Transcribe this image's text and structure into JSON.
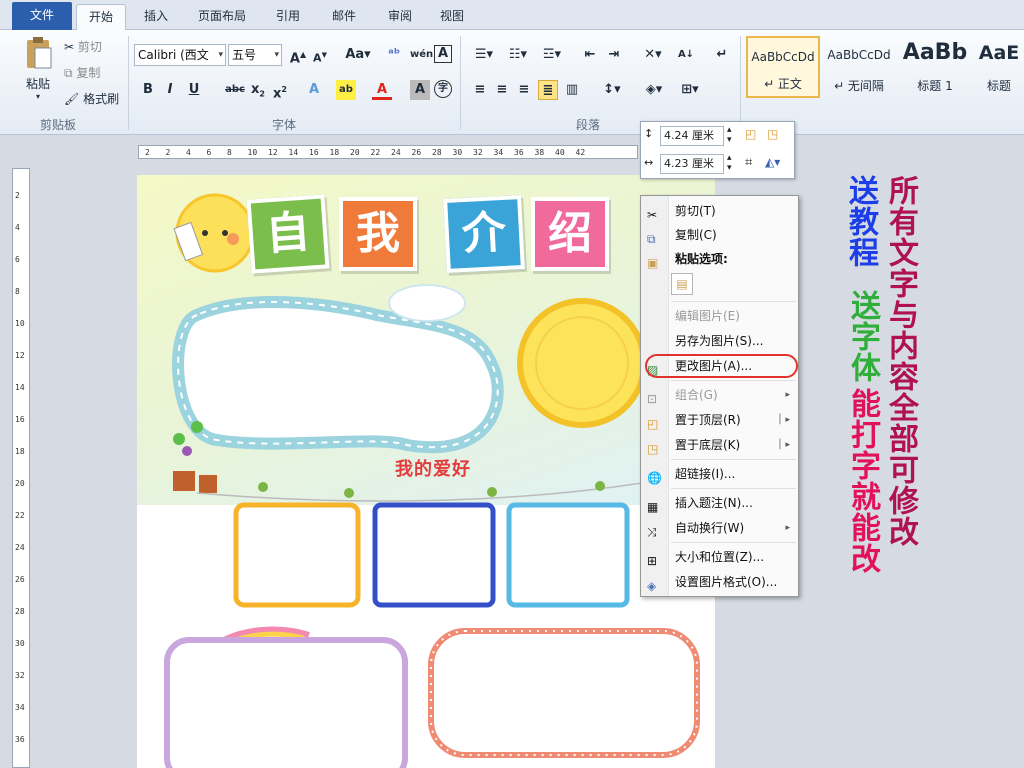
{
  "tabs": [
    "文件",
    "开始",
    "插入",
    "页面布局",
    "引用",
    "邮件",
    "审阅",
    "视图"
  ],
  "clipboard": {
    "paste": "粘贴",
    "cut": "剪切",
    "copy": "复制",
    "format_painter": "格式刷",
    "label": "剪贴板"
  },
  "font": {
    "name": "Calibri (西文",
    "size": "五号",
    "label": "字体"
  },
  "paragraph": {
    "label": "段落"
  },
  "styles": [
    {
      "sample": "AaBbCcDd",
      "name": "↵ 正文"
    },
    {
      "sample": "AaBbCcDd",
      "name": "↵ 无间隔"
    },
    {
      "sample": "AaBb",
      "name": "标题 1"
    },
    {
      "sample": "AaE",
      "name": "标题"
    }
  ],
  "ruler": {
    "h_ticks": [
      "2",
      "2",
      "4",
      "6",
      "8",
      "10",
      "12",
      "14",
      "16",
      "18",
      "20",
      "22",
      "24",
      "26",
      "28",
      "30",
      "32",
      "34",
      "36",
      "38",
      "40",
      "42"
    ],
    "v_ticks": [
      "2",
      "4",
      "6",
      "8",
      "10",
      "12",
      "14",
      "16",
      "18",
      "20",
      "22",
      "24",
      "26",
      "28",
      "30",
      "32",
      "34",
      "36"
    ]
  },
  "size_toolbar": {
    "height": "4.24 厘米",
    "width": "4.23 厘米"
  },
  "document": {
    "title_chars": [
      "自",
      "我",
      "介",
      "绍"
    ],
    "hobby_title": "我的爱好"
  },
  "context_menu": [
    {
      "label": "剪切(T)",
      "icon": "scissors-icon",
      "disabled": false
    },
    {
      "label": "复制(C)",
      "icon": "copy-icon",
      "disabled": false
    },
    {
      "label": "粘贴选项:",
      "icon": "paste-icon",
      "disabled": false,
      "bold": true
    },
    {
      "label": "编辑图片(E)",
      "icon": "",
      "disabled": true
    },
    {
      "label": "另存为图片(S)...",
      "icon": "",
      "disabled": false
    },
    {
      "label": "更改图片(A)...",
      "icon": "change-picture-icon",
      "disabled": false,
      "highlighted": true
    },
    {
      "label": "组合(G)",
      "icon": "group-icon",
      "disabled": true,
      "submenu": true
    },
    {
      "label": "置于顶层(R)",
      "icon": "bring-front-icon",
      "disabled": false,
      "submenu": true
    },
    {
      "label": "置于底层(K)",
      "icon": "send-back-icon",
      "disabled": false,
      "submenu": true
    },
    {
      "label": "超链接(I)...",
      "icon": "hyperlink-icon",
      "disabled": false
    },
    {
      "label": "插入题注(N)...",
      "icon": "caption-icon",
      "disabled": false
    },
    {
      "label": "自动换行(W)",
      "icon": "wrap-icon",
      "disabled": false,
      "submenu": true
    },
    {
      "label": "大小和位置(Z)...",
      "icon": "size-icon",
      "disabled": false
    },
    {
      "label": "设置图片格式(O)...",
      "icon": "format-picture-icon",
      "disabled": false
    }
  ],
  "promo": {
    "line1": "送教程",
    "line2": "送字体",
    "line3": "能打字就能改",
    "line4": "所有文字与内容全部可修改"
  },
  "colors": {
    "highlight": "#e2322d",
    "blue": "#1c3ee8",
    "green": "#2fae3a",
    "magenta": "#b0124f"
  }
}
